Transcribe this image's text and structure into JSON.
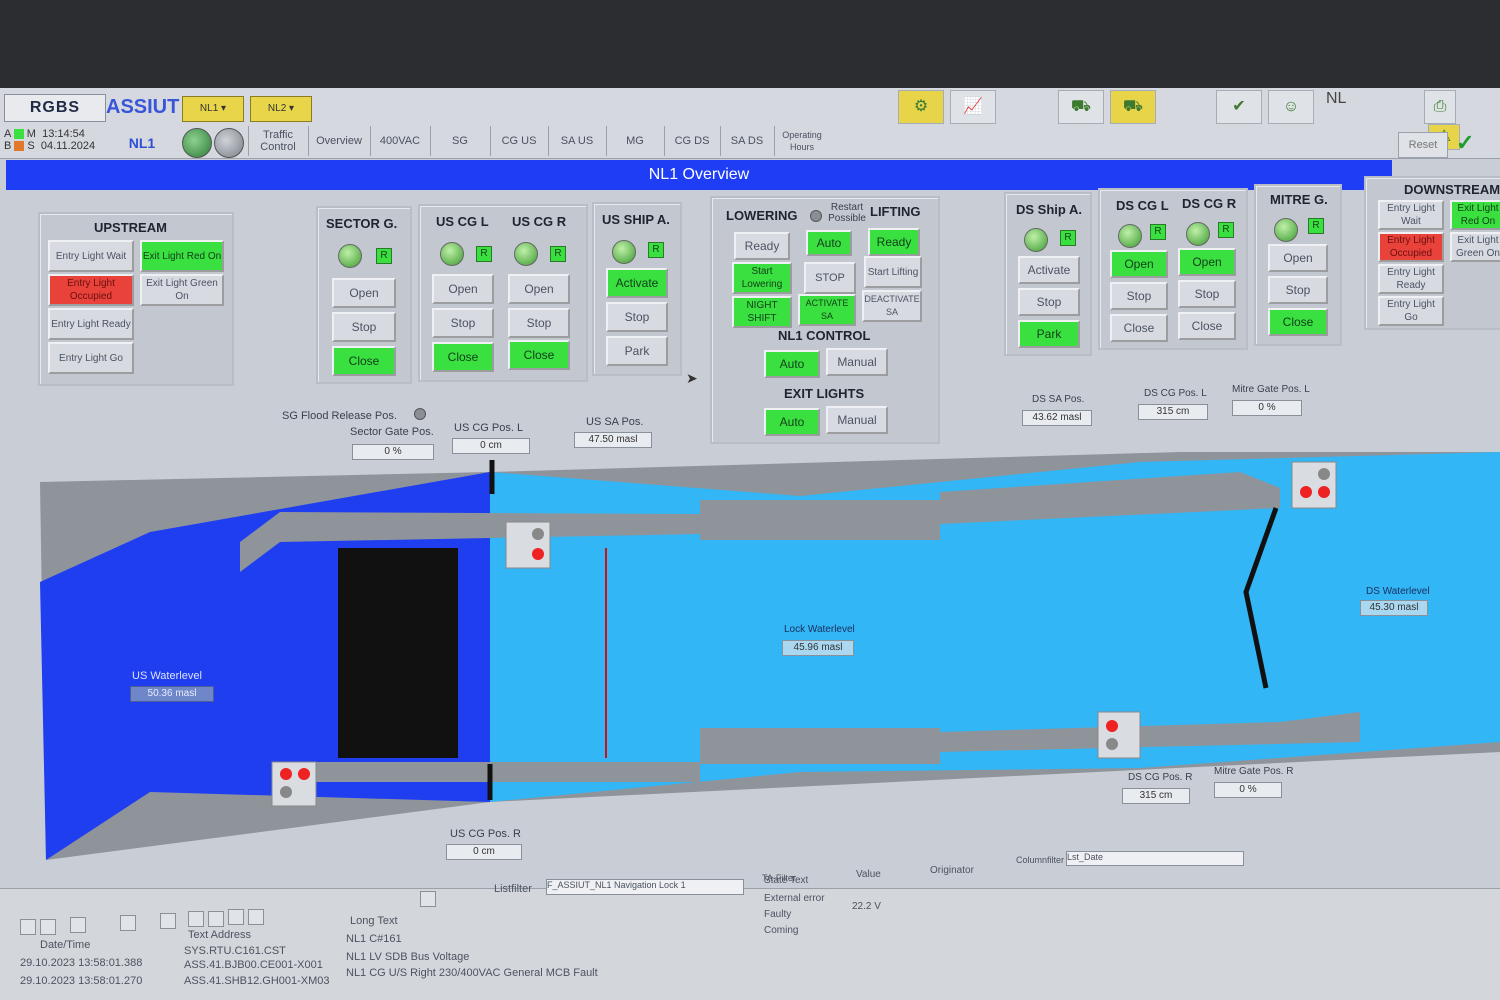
{
  "header": {
    "logo": "RGBS",
    "brand": "ASSIUT",
    "nl1_selector": "NL1",
    "nl2_selector": "NL2",
    "mode_a": "A",
    "mode_m": "M",
    "mode_b": "B",
    "mode_s": "S",
    "time": "13:14:54",
    "date": "04.11.2024",
    "current_lock": "NL1",
    "nl_code": "NL",
    "reset_label": "Reset",
    "confirm_symbol": "✓"
  },
  "nav_tabs": [
    {
      "label": "Traffic Control"
    },
    {
      "label": "Overview"
    },
    {
      "label": "400VAC"
    },
    {
      "label": "SG"
    },
    {
      "label": "CG US"
    },
    {
      "label": "SA US"
    },
    {
      "label": "MG"
    },
    {
      "label": "CG DS"
    },
    {
      "label": "SA DS"
    },
    {
      "label": "Operating Hours"
    }
  ],
  "title": "NL1 Overview",
  "upstream": {
    "title": "UPSTREAM",
    "entry_wait": "Entry Light Wait",
    "exit_red": "Exit Light Red On",
    "entry_occupied": "Entry Light Occupied",
    "exit_green": "Exit Light Green On",
    "entry_ready": "Entry Light Ready",
    "entry_go": "Entry Light Go"
  },
  "sector_gate": {
    "title": "SECTOR G.",
    "open": "Open",
    "stop": "Stop",
    "close": "Close",
    "r": "R"
  },
  "us_cg_l": {
    "title": "US CG L",
    "open": "Open",
    "stop": "Stop",
    "close": "Close",
    "r": "R"
  },
  "us_cg_r": {
    "title": "US CG R",
    "open": "Open",
    "stop": "Stop",
    "close": "Close",
    "r": "R"
  },
  "us_ship_a": {
    "title": "US SHIP A.",
    "activate": "Activate",
    "stop": "Stop",
    "park": "Park",
    "r": "R"
  },
  "lowering": {
    "title": "LOWERING",
    "restart": "Restart Possible",
    "ready": "Ready",
    "start": "Start Lowering",
    "night": "NIGHT SHIFT"
  },
  "middle": {
    "auto": "Auto",
    "stop": "STOP",
    "activate_sa": "ACTIVATE SA"
  },
  "lifting": {
    "title": "LIFTING",
    "ready": "Ready",
    "start": "Start Lifting",
    "deactivate_sa": "DEACTIVATE SA"
  },
  "nl1_control": {
    "title": "NL1 CONTROL",
    "auto": "Auto",
    "manual": "Manual"
  },
  "exit_lights": {
    "title": "EXIT LIGHTS",
    "auto": "Auto",
    "manual": "Manual"
  },
  "ds_ship_a": {
    "title": "DS Ship A.",
    "activate": "Activate",
    "stop": "Stop",
    "park": "Park",
    "r": "R"
  },
  "ds_cg_l": {
    "title": "DS CG L",
    "open": "Open",
    "stop": "Stop",
    "close": "Close",
    "r": "R"
  },
  "ds_cg_r": {
    "title": "DS CG R",
    "open": "Open",
    "stop": "Stop",
    "close": "Close",
    "r": "R"
  },
  "mitre_g": {
    "title": "MITRE G.",
    "open": "Open",
    "stop": "Stop",
    "close": "Close",
    "r": "R"
  },
  "downstream": {
    "title": "DOWNSTREAM",
    "entry_wait": "Entry Light Wait",
    "exit_red": "Exit Light Red On",
    "entry_occupied": "Entry Light Occupied",
    "exit_green": "Exit Light Green On",
    "entry_ready": "Entry Light Ready",
    "entry_go": "Entry Light Go"
  },
  "readouts": {
    "sg_flood": "SG Flood Release Pos.",
    "sector_gate_pos_label": "Sector Gate Pos.",
    "sector_gate_pos": "0 %",
    "us_cg_pos_l_label": "US CG Pos. L",
    "us_cg_pos_l": "0 cm",
    "us_sa_pos_label": "US SA Pos.",
    "us_sa_pos": "47.50 masl",
    "ds_sa_pos_label": "DS SA Pos.",
    "ds_sa_pos": "43.62 masl",
    "ds_cg_pos_l_label": "DS CG Pos. L",
    "ds_cg_pos_l": "315 cm",
    "mitre_gate_pos_l_label": "Mitre Gate Pos. L",
    "mitre_gate_pos_l": "0 %",
    "us_waterlevel_label": "US Waterlevel",
    "us_waterlevel": "50.36 masl",
    "lock_waterlevel_label": "Lock Waterlevel",
    "lock_waterlevel": "45.96 masl",
    "ds_waterlevel_label": "DS Waterlevel",
    "ds_waterlevel": "45.30 masl",
    "us_cg_pos_r_label": "US CG Pos. R",
    "us_cg_pos_r": "0 cm",
    "ds_cg_pos_r_label": "DS CG Pos. R",
    "ds_cg_pos_r": "315 cm",
    "mitre_gate_pos_r_label": "Mitre Gate Pos. R",
    "mitre_gate_pos_r": "0 %"
  },
  "alarms": {
    "list_filter_label": "Listfilter",
    "list_filter_value": "F_ASSIUT_NL1 Navigation Lock 1",
    "ta_filter_label": "TA-Filter",
    "col_date": "Date/Time",
    "col_address": "Text Address",
    "col_long": "Long Text",
    "col_state": "State Text",
    "col_value": "Value",
    "col_originator": "Originator",
    "state_external": "External error",
    "state_faulty": "Faulty",
    "state_coming": "Coming",
    "state_value": "22.2 V",
    "rows": [
      {
        "date": "",
        "address": "SYS.RTU.C161.CST",
        "text": "NL1 C#161"
      },
      {
        "date": "29.10.2023 13:58:01.388",
        "address": "ASS.41.BJB00.CE001-X001",
        "text": "NL1 LV SDB Bus Voltage"
      },
      {
        "date": "29.10.2023 13:58:01.270",
        "address": "ASS.41.SHB12.GH001-XM03",
        "text": "NL1 CG U/S Right 230/400VAC General MCB Fault"
      }
    ],
    "column_filter_label": "Columnfilter",
    "column_filter_value": "Lst_Date"
  },
  "colors": {
    "upstream_water": "#1f3ef0",
    "lock_water": "#33b6f5",
    "green_active": "#39e040",
    "red_alarm": "#e8423a",
    "title_bar": "#1e3df5"
  }
}
